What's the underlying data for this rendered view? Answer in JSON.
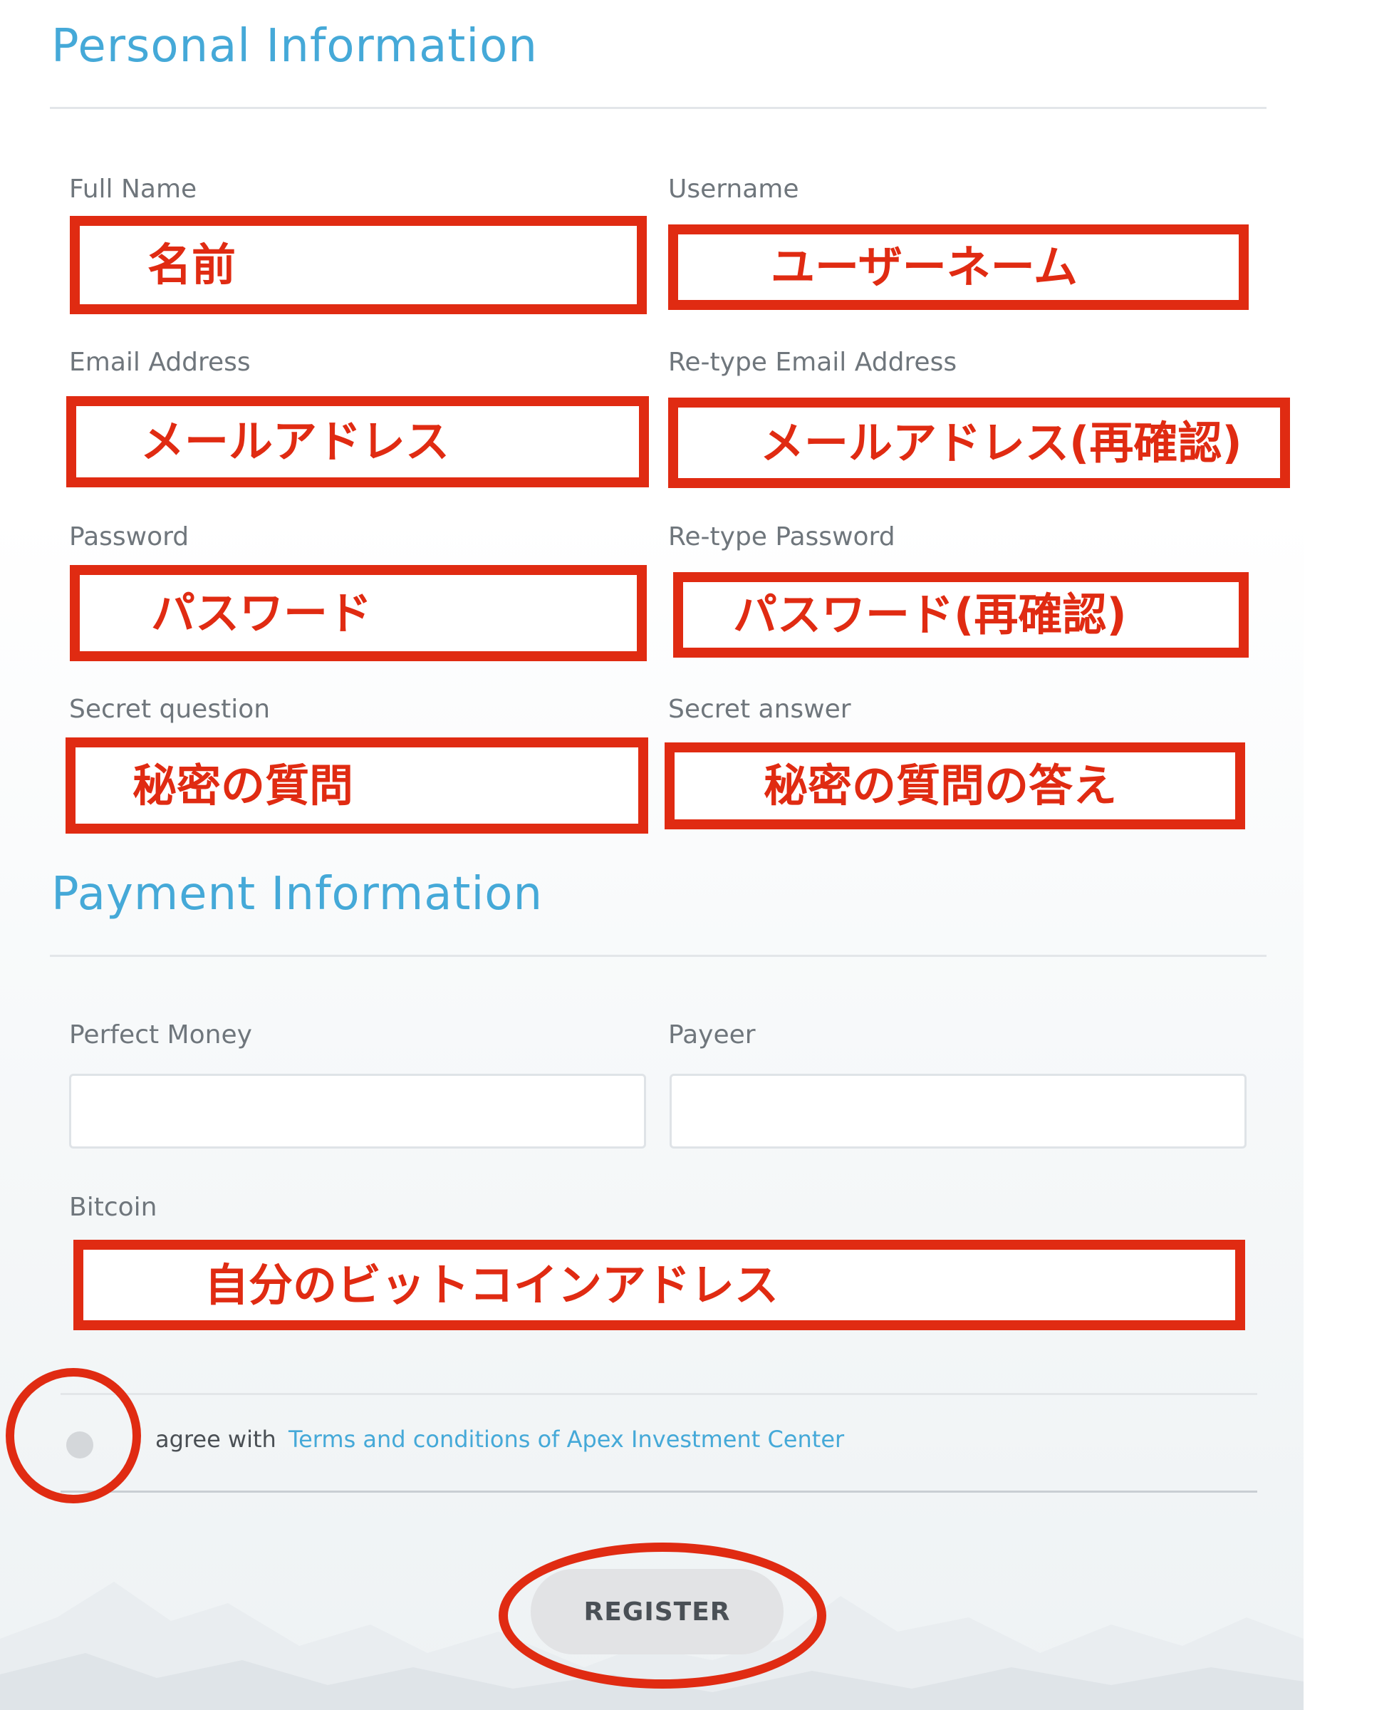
{
  "personal_section": {
    "title": "Personal Information",
    "full_name": {
      "label": "Full Name",
      "annotation": "名前"
    },
    "username": {
      "label": "Username",
      "annotation": "ユーザーネーム"
    },
    "email": {
      "label": "Email Address",
      "annotation": "メールアドレス"
    },
    "email_retype": {
      "label": "Re-type Email Address",
      "annotation": "メールアドレス(再確認)"
    },
    "password": {
      "label": "Password",
      "annotation": "パスワード"
    },
    "password_retype": {
      "label": "Re-type Password",
      "annotation": "パスワード(再確認)"
    },
    "secret_question": {
      "label": "Secret question",
      "annotation": "秘密の質問"
    },
    "secret_answer": {
      "label": "Secret answer",
      "annotation": "秘密の質問の答え"
    }
  },
  "payment_section": {
    "title": "Payment Information",
    "perfect_money": {
      "label": "Perfect Money",
      "value": ""
    },
    "payeer": {
      "label": "Payeer",
      "value": ""
    },
    "bitcoin": {
      "label": "Bitcoin",
      "annotation": "自分のビットコインアドレス"
    }
  },
  "agreement": {
    "text": "agree with",
    "link": "Terms and conditions of Apex Investment Center",
    "checked": false
  },
  "register_button": {
    "label": "REGISTER"
  },
  "colors": {
    "heading": "#45a9d8",
    "link": "#45a9d8",
    "annotation_red": "#e02b12",
    "label_gray": "#6f767c",
    "button_bg": "#e2e3e5"
  }
}
